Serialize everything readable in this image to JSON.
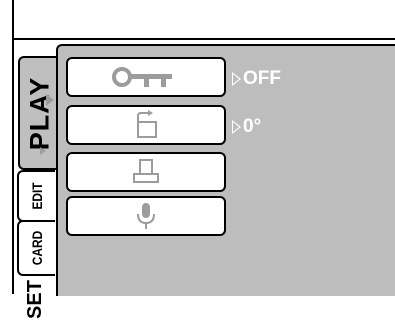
{
  "tabs": {
    "play": "PLAY",
    "edit": "EDIT",
    "card": "CARD",
    "set": "SET"
  },
  "menu": {
    "items": [
      {
        "icon": "key-icon",
        "value": "OFF"
      },
      {
        "icon": "rotate-icon",
        "value": "0°"
      },
      {
        "icon": "print-icon"
      },
      {
        "icon": "microphone-icon"
      }
    ]
  },
  "colors": {
    "panel": "#bdbdbd",
    "icon": "#9c9c9c",
    "value_text": "#ffffff"
  }
}
